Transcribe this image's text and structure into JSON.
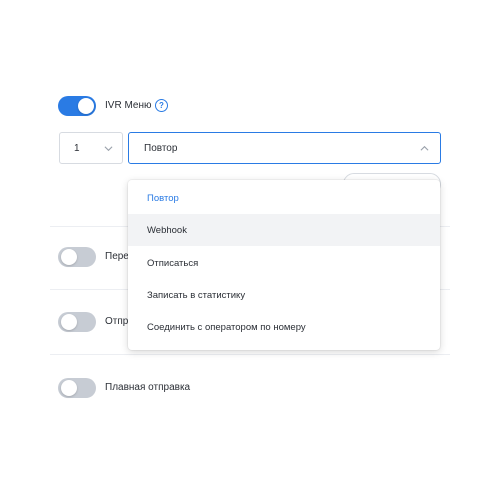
{
  "ivr": {
    "toggle_on": true,
    "label": "IVR Меню",
    "help_icon": "question-circle-icon"
  },
  "key_select": {
    "value": "1"
  },
  "action_select": {
    "value": "Повтор",
    "options": [
      {
        "label": "Повтор",
        "selected": true
      },
      {
        "label": "Webhook",
        "hovered": true
      },
      {
        "label": "Отписаться"
      },
      {
        "label": "Записать в статистику"
      },
      {
        "label": "Соединить с оператором по номеру"
      }
    ]
  },
  "settings": [
    {
      "label": "Пере",
      "toggle_on": false
    },
    {
      "label": "Отпр",
      "toggle_on": false
    },
    {
      "label": "Плавная отправка",
      "toggle_on": false
    }
  ],
  "colors": {
    "accent": "#2a7be4",
    "toggle_off": "#c7ccd4",
    "hover_bg": "#f2f3f5"
  }
}
